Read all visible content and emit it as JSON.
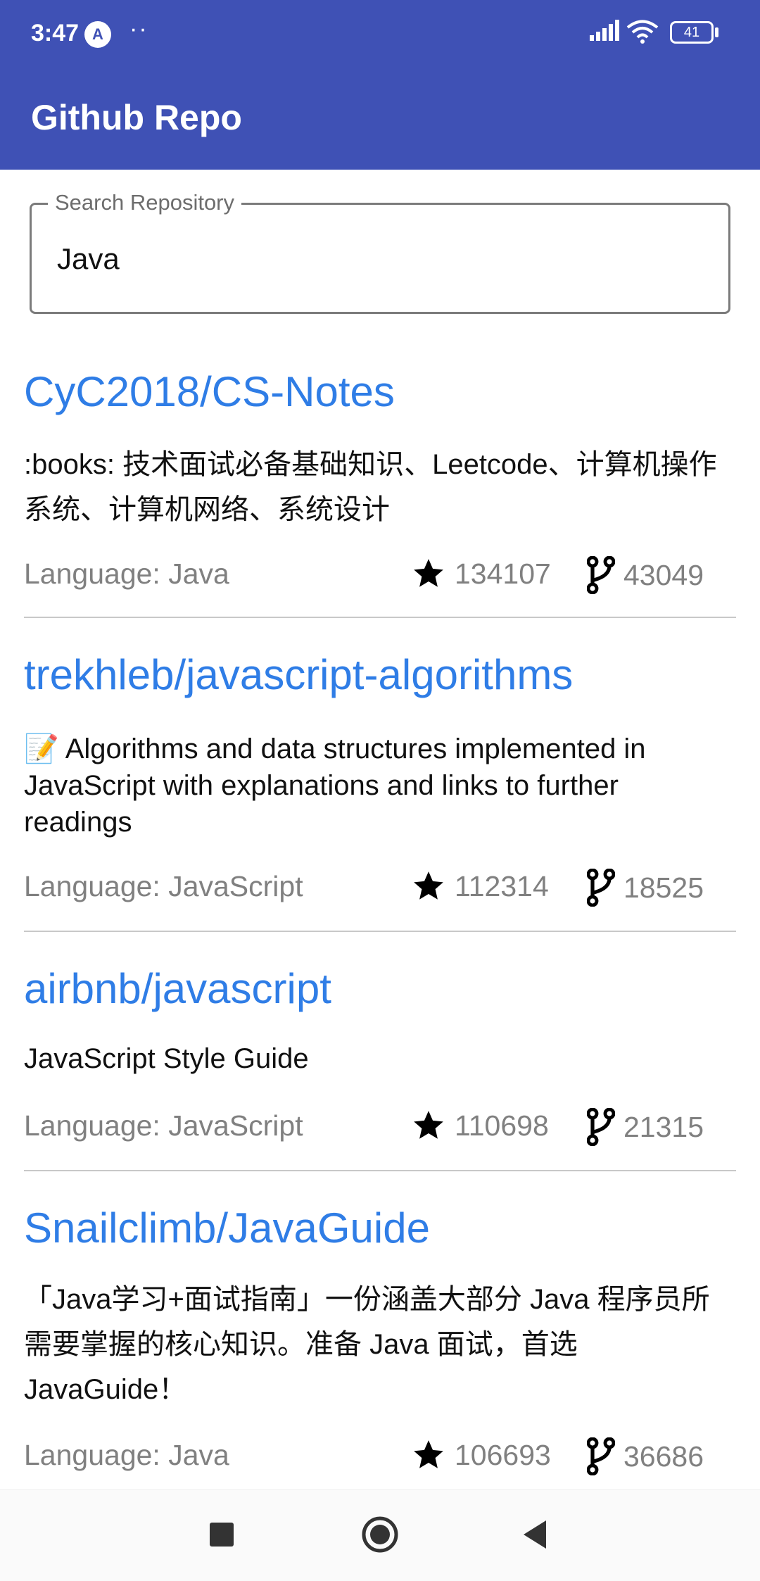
{
  "status_bar": {
    "time": "3:47",
    "badge": "A",
    "dots": "··",
    "battery": "41"
  },
  "app": {
    "title": "Github Repo"
  },
  "search": {
    "label": "Search Repository",
    "value": "Java"
  },
  "repos": [
    {
      "name": "CyC2018/CS-Notes",
      "description": ":books: 技术面试必备基础知识、Leetcode、计算机操作系统、计算机网络、系统设计",
      "language": "Language: Java",
      "stars": "134107",
      "forks": "43049"
    },
    {
      "name": "trekhleb/javascript-algorithms",
      "description": "📝 Algorithms and data structures implemented in JavaScript with explanations and links to further readings",
      "language": "Language: JavaScript",
      "stars": "112314",
      "forks": "18525"
    },
    {
      "name": "airbnb/javascript",
      "description": "JavaScript Style Guide",
      "language": "Language: JavaScript",
      "stars": "110698",
      "forks": "21315"
    },
    {
      "name": "Snailclimb/JavaGuide",
      "description": "「Java学习+面试指南」一份涵盖大部分 Java 程序员所需要掌握的核心知识。准备 Java 面试，首选 JavaGuide！",
      "language": "Language: Java",
      "stars": "106693",
      "forks": "36686"
    }
  ],
  "icons": {
    "star": "star-icon",
    "fork": "fork-icon",
    "nav_recents": "square-icon",
    "nav_home": "circle-icon",
    "nav_back": "triangle-back-icon"
  },
  "colors": {
    "app_bar": "#3f51b5",
    "repo_name": "#2f7de6",
    "meta_text": "#808080"
  }
}
